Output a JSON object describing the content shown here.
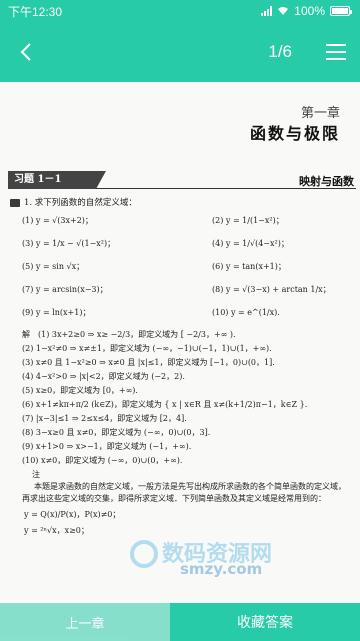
{
  "status": {
    "time": "下午12:30",
    "battery": "100%",
    "battery_level": 1.0
  },
  "nav": {
    "page_indicator": "1/6",
    "back_icon": "chevron-left-icon",
    "menu_icon": "menu-icon"
  },
  "document": {
    "chapter_no": "第一章",
    "chapter_title": "函数与极限",
    "section_tag": "习题 1－1",
    "section_title": "映射与函数",
    "question": "1. 求下列函数的自然定义域：",
    "items": [
      "(1) y = √(3x+2)；",
      "(2) y = 1/(1−x²)；",
      "(3) y = 1/x − √(1−x²)；",
      "(4) y = 1/√(4−x²)；",
      "(5) y = sin √x；",
      "(6) y = tan(x+1)；",
      "(7) y = arcsin(x−3)；",
      "(8) y = √(3−x) + arctan 1/x；",
      "(9) y = ln(x+1)；",
      "(10) y = e^(1/x)."
    ],
    "solutions": [
      "解　(1) 3x+2≥0 ⇒ x≥ −2/3，即定义域为 [ −2/3，+∞ ).",
      "(2) 1−x²≠0 ⇒ x≠±1，即定义域为 (−∞，−1)∪(−1，1)∪(1，+∞).",
      "(3) x≠0 且 1−x²≥0 ⇒ x≠0 且 |x|≤1，即定义域为 [−1，0)∪(0，1].",
      "(4) 4−x²>0 ⇒ |x|<2，即定义域为 (−2，2).",
      "(5) x≥0，即定义域为 [0，+∞).",
      "(6) x+1≠kπ+π/2 (k∈Z)，即定义域为 { x | x∈R 且 x≠(k+1/2)π−1，k∈Z }.",
      "(7) |x−3|≤1 ⇒ 2≤x≤4，即定义域为 [2，4].",
      "(8) 3−x≥0 且 x≠0，即定义域为 (−∞，0)∪(0，3].",
      "(9) x+1>0 ⇒ x>−1，即定义域为 (−1，+∞).",
      "(10) x≠0，即定义域为 (−∞，0)∪(0，+∞)."
    ],
    "note_label": "注",
    "note_text": "本题是求函数的自然定义域，一般方法是先写出构成所求函数的各个简单函数的定义域，再求出这些定义域的交集，即得所求定义域．下列简单函数及其定义域是经常用到的：",
    "formulas": [
      "y = Q(x)/P(x)，P(x)≠0；",
      "y = ²ⁿ√x，x≥0；"
    ]
  },
  "bottom": {
    "prev_label": "上一章",
    "answer_label": "收藏答案"
  },
  "watermark": {
    "title": "数码资源网",
    "url": "smzy.com"
  },
  "colors": {
    "accent": "#28cba7"
  }
}
